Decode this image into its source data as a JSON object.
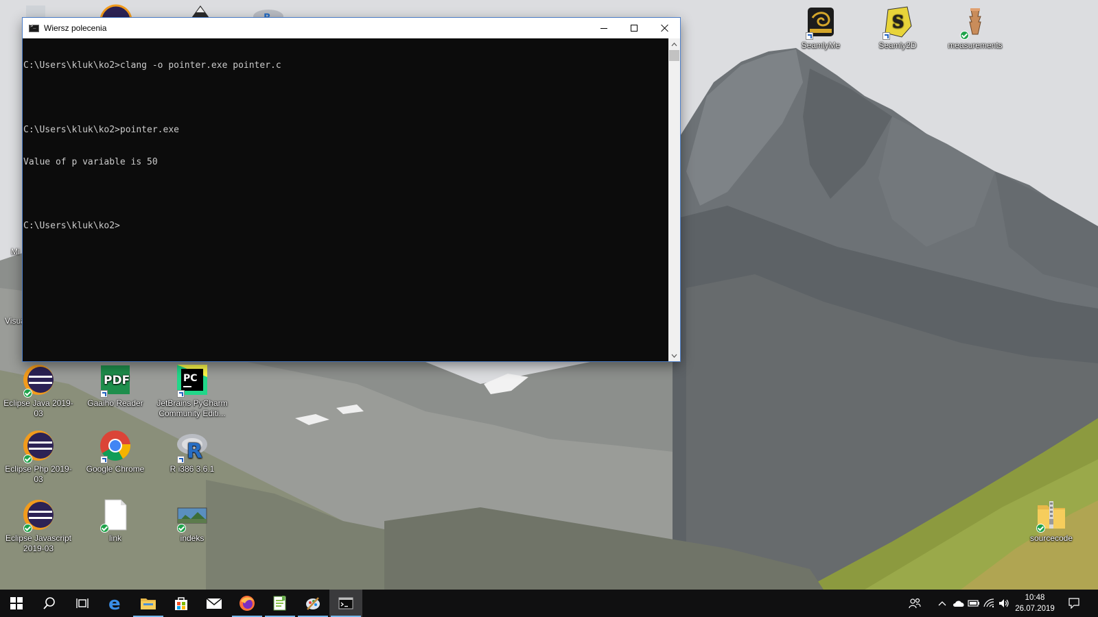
{
  "console": {
    "title": "Wiersz polecenia",
    "lines": [
      "C:\\Users\\kluk\\ko2>clang -o pointer.exe pointer.c",
      "",
      "C:\\Users\\kluk\\ko2>pointer.exe",
      "Value of p variable is 50",
      "",
      "C:\\Users\\kluk\\ko2>"
    ]
  },
  "desktop": {
    "partial_labels": {
      "left1": "Mi",
      "left2": "Visua"
    },
    "icons": {
      "seamlyme": {
        "label": "SeamlyMe",
        "icon": "seamlyme-icon"
      },
      "seamly2d": {
        "label": "Seamly2D",
        "icon": "seamly2d-icon"
      },
      "measurements": {
        "label": "measurements",
        "icon": "measurements-icon"
      },
      "eclipse_java": {
        "label": "Eclipse Java 2019-03",
        "icon": "eclipse-icon"
      },
      "gaaiho": {
        "label": "Gaaiho Reader",
        "icon": "pdf-icon"
      },
      "pycharm": {
        "label": "JetBrains PyCharm Community Editi...",
        "icon": "pycharm-icon"
      },
      "eclipse_php": {
        "label": "Eclipse Php 2019-03",
        "icon": "eclipse-icon"
      },
      "chrome": {
        "label": "Google Chrome",
        "icon": "chrome-icon"
      },
      "r_i386": {
        "label": "R i386 3.6.1",
        "icon": "r-icon"
      },
      "eclipse_js": {
        "label": "Eclipse Javascript 2019-03",
        "icon": "eclipse-icon"
      },
      "link": {
        "label": "link",
        "icon": "file-icon"
      },
      "indeks": {
        "label": "indeks",
        "icon": "image-icon"
      },
      "sourcecode": {
        "label": "sourcecode",
        "icon": "zip-folder-icon"
      }
    }
  },
  "taskbar": {
    "clock_time": "10:48",
    "clock_date": "26.07.2019"
  },
  "colors": {
    "console_bg": "#0c0c0c",
    "console_text": "#cccccc",
    "taskbar_bg": "#101011",
    "taskbar_active": "#76b9ed"
  }
}
